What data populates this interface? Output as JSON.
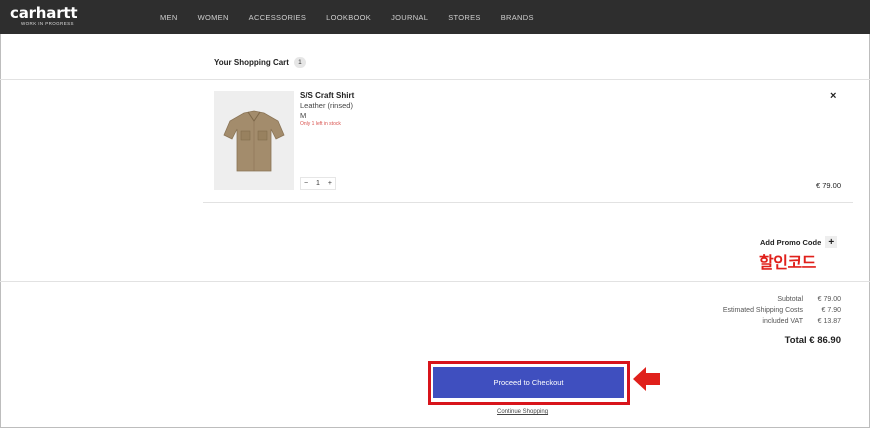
{
  "header": {
    "logo": "carhartt",
    "logo_tagline": "WORK IN PROGRESS",
    "nav": [
      "MEN",
      "WOMEN",
      "ACCESSORIES",
      "LOOKBOOK",
      "JOURNAL",
      "STORES",
      "BRANDS"
    ]
  },
  "cart": {
    "title": "Your Shopping Cart",
    "count": "1"
  },
  "item": {
    "name": "S/S Craft Shirt",
    "color": "Leather (rinsed)",
    "size": "M",
    "stock_note": "Only 1 left in stock",
    "quantity": "1",
    "minus": "−",
    "plus": "+",
    "remove": "×",
    "price": "€ 79.00"
  },
  "promo": {
    "label": "Add Promo Code",
    "plus": "+",
    "annotation": "할인코드"
  },
  "summary": {
    "rows": [
      {
        "label": "Subtotal",
        "value": "€ 79.00"
      },
      {
        "label": "Estimated Shipping Costs",
        "value": "€ 7.90"
      },
      {
        "label": "included VAT",
        "value": "€ 13.87"
      }
    ],
    "total": "Total € 86.90"
  },
  "actions": {
    "checkout": "Proceed to Checkout",
    "continue": "Continue Shopping"
  },
  "colors": {
    "topbar": "#2e2e2e",
    "checkout_button": "#3f4fbf",
    "annotation_red": "#e0201b",
    "stock_warning": "#d9534f"
  },
  "icons": {
    "remove": "close-icon",
    "annotation_arrow": "arrow-left-icon"
  }
}
